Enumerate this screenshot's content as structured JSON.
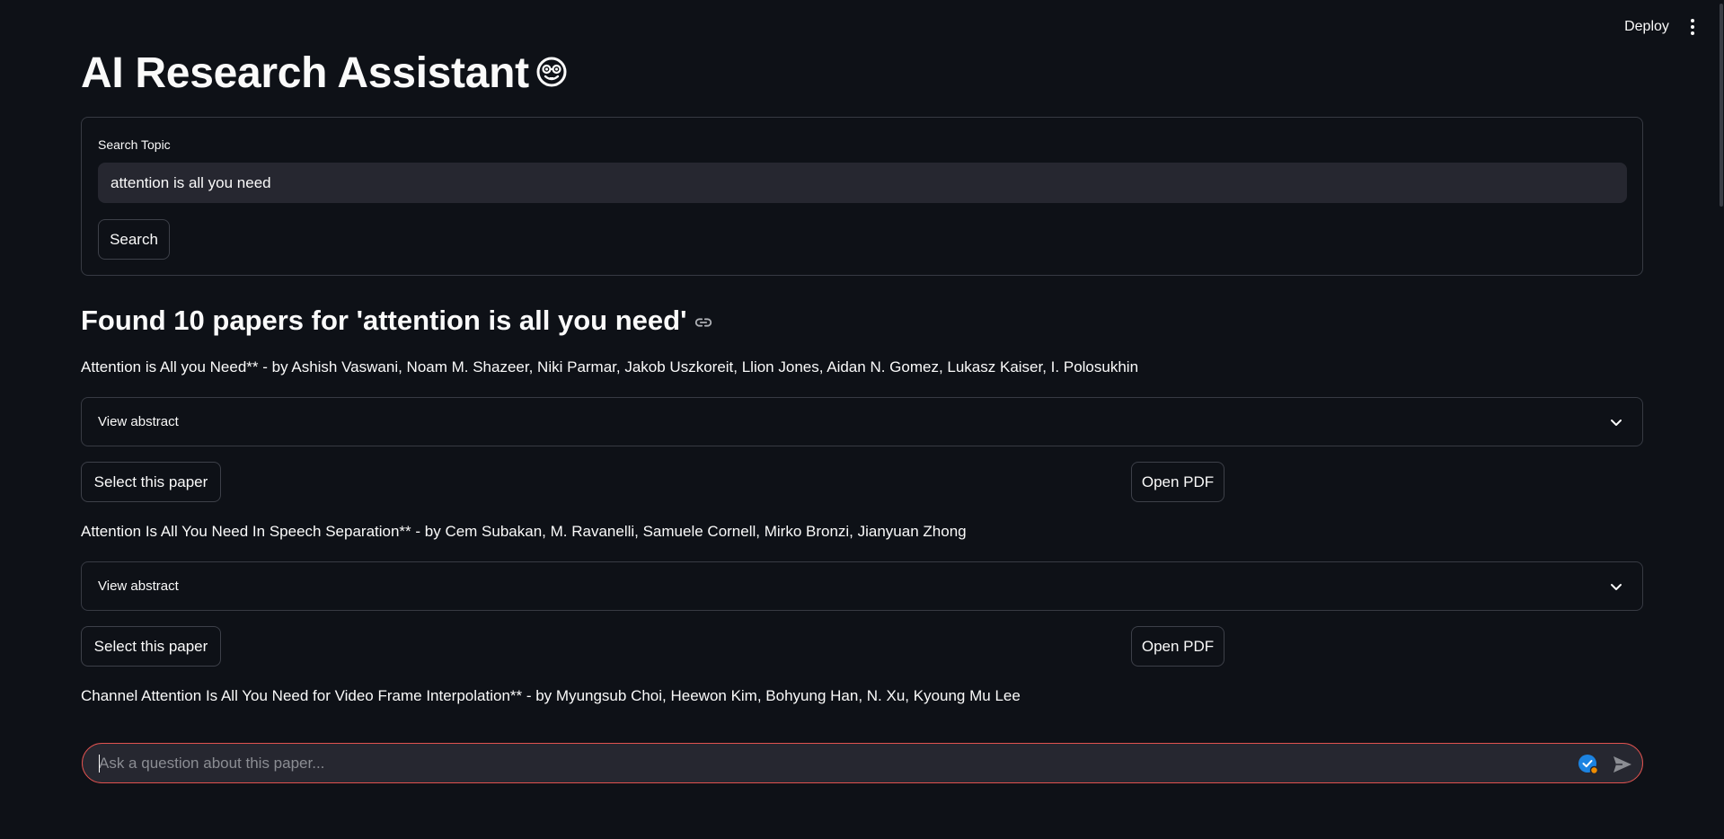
{
  "header": {
    "deploy_label": "Deploy",
    "menu_icon": "vertical-dots-icon"
  },
  "page": {
    "title": "AI Research Assistant",
    "title_icon": "nerd-face-emoji-icon"
  },
  "form": {
    "label": "Search Topic",
    "value": "attention is all you need",
    "button_label": "Search"
  },
  "results": {
    "heading": "Found 10 papers for 'attention is all you need'",
    "heading_icon": "link-icon",
    "papers": [
      {
        "text": "Attention is All you Need** - by Ashish Vaswani, Noam M. Shazeer, Niki Parmar, Jakob Uszkoreit, Llion Jones, Aidan N. Gomez, Lukasz Kaiser, I. Polosukhin",
        "expander_label": "View abstract",
        "select_label": "Select this paper",
        "pdf_label": "Open PDF"
      },
      {
        "text": "Attention Is All You Need In Speech Separation** - by Cem Subakan, M. Ravanelli, Samuele Cornell, Mirko Bronzi, Jianyuan Zhong",
        "expander_label": "View abstract",
        "select_label": "Select this paper",
        "pdf_label": "Open PDF"
      },
      {
        "text": "Channel Attention Is All You Need for Video Frame Interpolation** - by Myungsub Choi, Heewon Kim, Bohyung Han, N. Xu, Kyoung Mu Lee"
      }
    ]
  },
  "chat": {
    "placeholder": "Ask a question about this paper...",
    "value": "",
    "check_icon": "checkmark-badge-icon",
    "send_icon": "send-icon"
  },
  "colors": {
    "background": "#0e1117",
    "input_bg": "#262730",
    "border": "#373a43",
    "chat_border": "#e0524f",
    "badge_blue": "#1c83e1",
    "badge_dot": "#f08c00"
  }
}
